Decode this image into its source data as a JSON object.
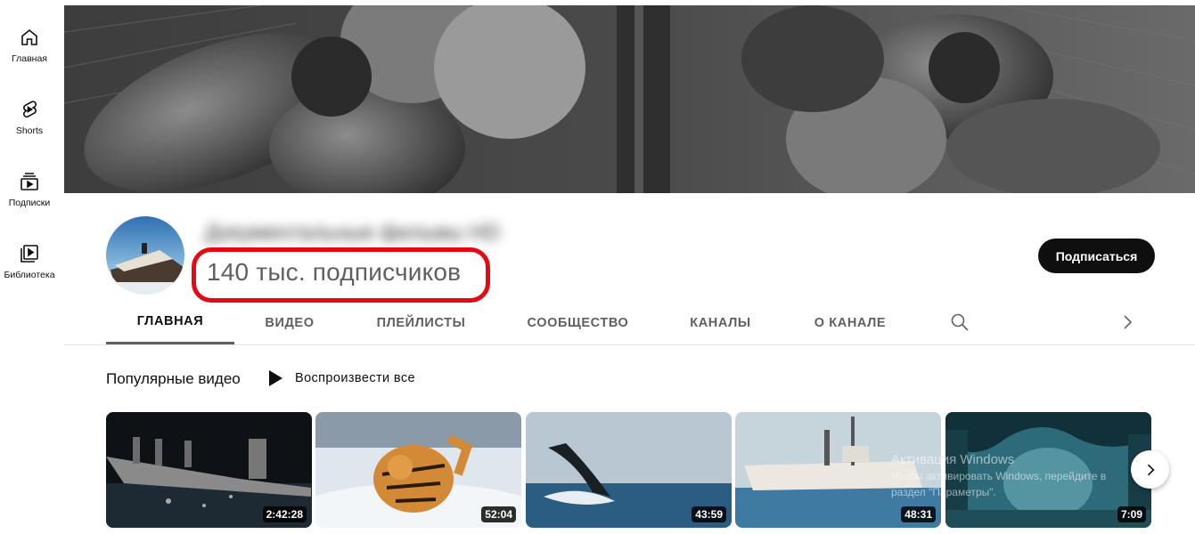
{
  "guide": {
    "items": [
      {
        "label": "Главная",
        "icon": "home-icon"
      },
      {
        "label": "Shorts",
        "icon": "shorts-icon"
      },
      {
        "label": "Подписки",
        "icon": "subscriptions-icon"
      },
      {
        "label": "Библиотека",
        "icon": "library-icon"
      }
    ]
  },
  "channel": {
    "name": "Документальные фильмы HD",
    "subscribers": "140 тыс. подписчиков",
    "subscribe_label": "Подписаться"
  },
  "tabs": [
    {
      "label": "ГЛАВНАЯ",
      "active": true
    },
    {
      "label": "ВИДЕО",
      "active": false
    },
    {
      "label": "ПЛЕЙЛИСТЫ",
      "active": false
    },
    {
      "label": "СООБЩЕСТВО",
      "active": false
    },
    {
      "label": "КАНАЛЫ",
      "active": false
    },
    {
      "label": "О КАНАЛЕ",
      "active": false
    }
  ],
  "section": {
    "title": "Популярные видео",
    "play_all_label": "Воспроизвести все"
  },
  "videos": [
    {
      "duration": "2:42:28"
    },
    {
      "duration": "52:04"
    },
    {
      "duration": "43:59"
    },
    {
      "duration": "48:31"
    },
    {
      "duration": "7:09"
    }
  ],
  "watermark": {
    "line1": "Активация Windows",
    "line2": "Чтобы активировать Windows, перейдите в",
    "line3": "раздел \"Параметры\"."
  },
  "colors": {
    "highlight": "#e50914",
    "subscribe_bg": "#0f0f0f",
    "text_secondary": "#606060"
  }
}
